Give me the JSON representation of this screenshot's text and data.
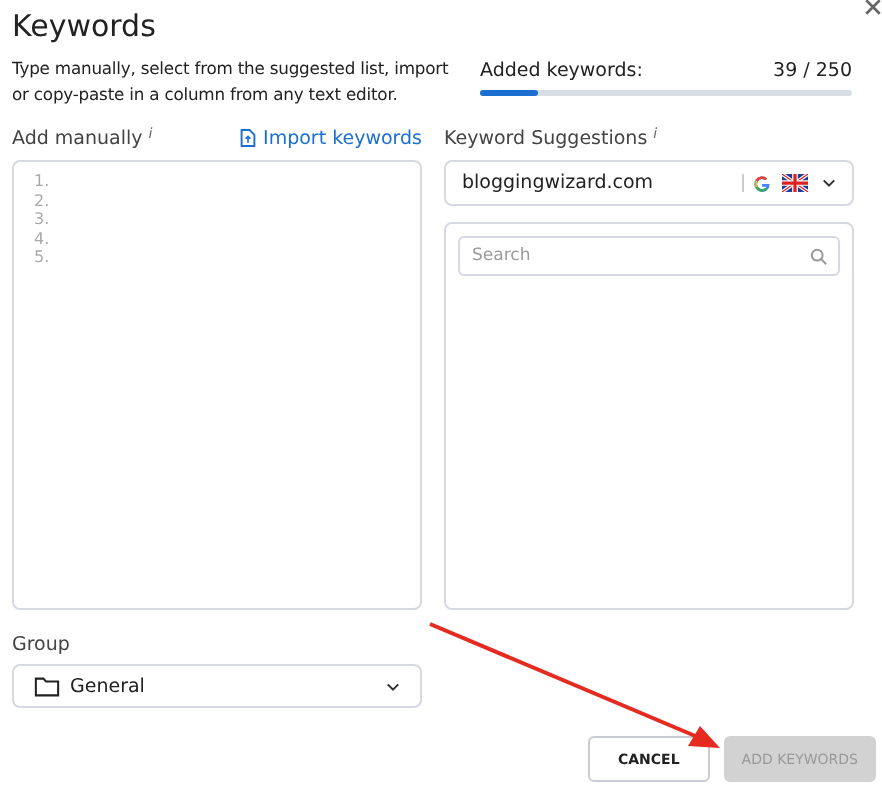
{
  "title": "Keywords",
  "description": "Type manually, select from the suggested list, import or copy-paste in a column from any text editor.",
  "counter": {
    "label": "Added keywords:",
    "value": "39 / 250",
    "level": 0.156
  },
  "manual": {
    "label": "Add manually",
    "info": "i",
    "import_link": "Import keywords",
    "line_numbers": [
      "1.",
      "2.",
      "3.",
      "4.",
      "5."
    ]
  },
  "suggestions": {
    "label": "Keyword Suggestions",
    "info": "i",
    "domain": "bloggingwizard.com",
    "search": {
      "placeholder": "Search"
    }
  },
  "group": {
    "label": "Group",
    "value": "General"
  },
  "buttons": [
    {
      "label": "CANCEL",
      "disabled": false
    },
    {
      "label": "ADD KEYWORDS",
      "disabled": true
    }
  ]
}
